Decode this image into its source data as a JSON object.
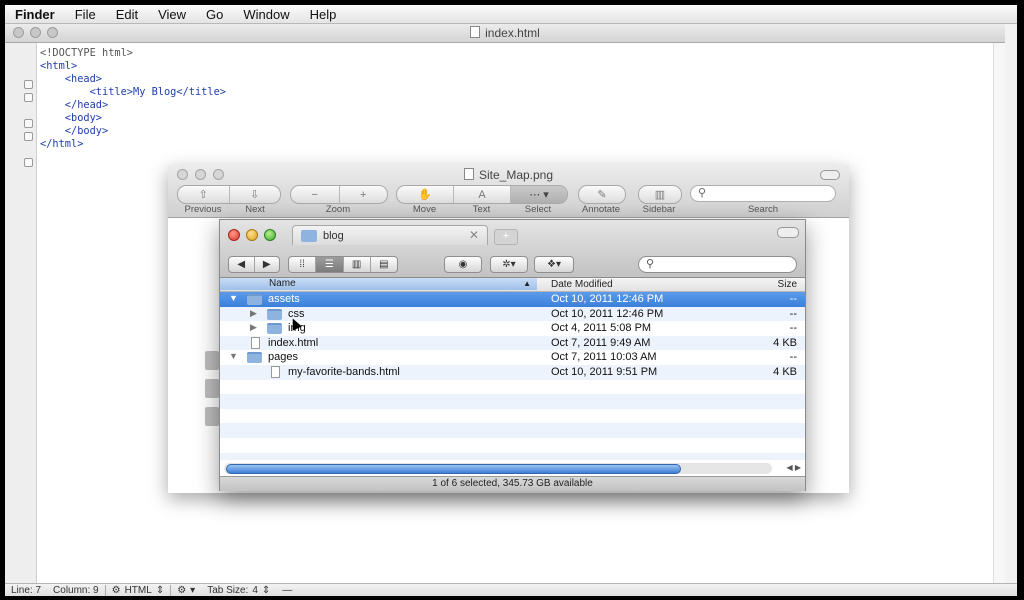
{
  "menubar": {
    "items": [
      "Finder",
      "File",
      "Edit",
      "View",
      "Go",
      "Window",
      "Help"
    ]
  },
  "editor": {
    "title": "index.html",
    "code_lines": [
      "<!DOCTYPE html>",
      "<html>",
      "    <head>",
      "        <title>My Blog</title>",
      "    </head>",
      "    <body>",
      "",
      "    </body>",
      "</html>"
    ]
  },
  "statusbar": {
    "line": "Line: 7",
    "column": "Column: 9",
    "language": "HTML",
    "tab_size_label": "Tab Size:",
    "tab_size_value": "4",
    "extra": "—"
  },
  "preview": {
    "title": "Site_Map.png",
    "toolbar": {
      "previous": "Previous",
      "next": "Next",
      "zoom": "Zoom",
      "move": "Move",
      "text": "Text",
      "select": "Select",
      "annotate": "Annotate",
      "sidebar": "Sidebar",
      "search": "Search"
    }
  },
  "finder": {
    "tab_title": "blog",
    "columns": {
      "name": "Name",
      "date": "Date Modified",
      "size": "Size"
    },
    "rows": [
      {
        "name": "assets",
        "date": "Oct 10, 2011 12:46 PM",
        "size": "--",
        "selected": true
      },
      {
        "name": "css",
        "date": "Oct 10, 2011 12:46 PM",
        "size": "--"
      },
      {
        "name": "img",
        "date": "Oct 4, 2011 5:08 PM",
        "size": "--"
      },
      {
        "name": "index.html",
        "date": "Oct 7, 2011 9:49 AM",
        "size": "4 KB"
      },
      {
        "name": "pages",
        "date": "Oct 7, 2011 10:03 AM",
        "size": "--"
      },
      {
        "name": "my-favorite-bands.html",
        "date": "Oct 10, 2011 9:51 PM",
        "size": "4 KB"
      }
    ],
    "status": "1 of 6 selected, 345.73 GB available"
  },
  "colors": {
    "selection": "#3a7fdb",
    "tag": "#1f3fa8"
  }
}
